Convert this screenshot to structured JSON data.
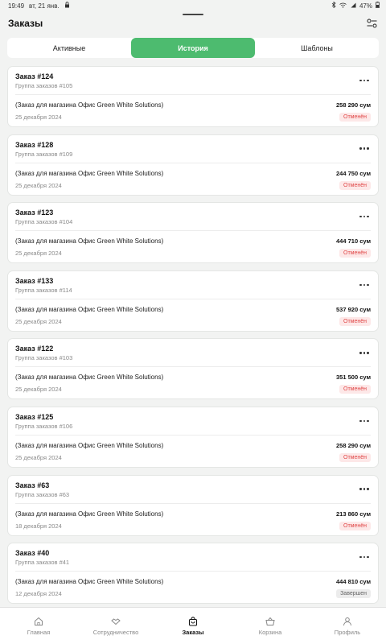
{
  "status_bar": {
    "time": "19:49",
    "date": "вт, 21 янв.",
    "battery": "47%"
  },
  "header": {
    "title": "Заказы"
  },
  "tabs": [
    {
      "label": "Активные",
      "active": false
    },
    {
      "label": "История",
      "active": true
    },
    {
      "label": "Шаблоны",
      "active": false
    }
  ],
  "orders": [
    {
      "title": "Заказ #124",
      "group": "Группа заказов #105",
      "shop": "(Заказ для магазина Офис Green White Solutions)",
      "date": "25 декабря 2024",
      "amount": "258 290 сум",
      "status": "Отменён",
      "status_type": "cancelled"
    },
    {
      "title": "Заказ #128",
      "group": "Группа заказов #109",
      "shop": "(Заказ для магазина Офис Green White Solutions)",
      "date": "25 декабря 2024",
      "amount": "244 750 сум",
      "status": "Отменён",
      "status_type": "cancelled"
    },
    {
      "title": "Заказ #123",
      "group": "Группа заказов #104",
      "shop": "(Заказ для магазина Офис Green White Solutions)",
      "date": "25 декабря 2024",
      "amount": "444 710 сум",
      "status": "Отменён",
      "status_type": "cancelled"
    },
    {
      "title": "Заказ #133",
      "group": "Группа заказов #114",
      "shop": "(Заказ для магазина Офис Green White Solutions)",
      "date": "25 декабря 2024",
      "amount": "537 920 сум",
      "status": "Отменён",
      "status_type": "cancelled"
    },
    {
      "title": "Заказ #122",
      "group": "Группа заказов #103",
      "shop": "(Заказ для магазина Офис Green White Solutions)",
      "date": "25 декабря 2024",
      "amount": "351 500 сум",
      "status": "Отменён",
      "status_type": "cancelled"
    },
    {
      "title": "Заказ #125",
      "group": "Группа заказов #106",
      "shop": "(Заказ для магазина Офис Green White Solutions)",
      "date": "25 декабря 2024",
      "amount": "258 290 сум",
      "status": "Отменён",
      "status_type": "cancelled"
    },
    {
      "title": "Заказ #63",
      "group": "Группа заказов #63",
      "shop": "(Заказ для магазина Офис Green White Solutions)",
      "date": "18 декабря 2024",
      "amount": "213 860 сум",
      "status": "Отменён",
      "status_type": "cancelled"
    },
    {
      "title": "Заказ #40",
      "group": "Группа заказов #41",
      "shop": "(Заказ для магазина Офис Green White Solutions)",
      "date": "12 декабря 2024",
      "amount": "444 810 сум",
      "status": "Завершен",
      "status_type": "done"
    }
  ],
  "bottom_nav": [
    {
      "label": "Главная",
      "icon": "home-icon",
      "active": false
    },
    {
      "label": "Сотрудничество",
      "icon": "handshake-icon",
      "active": false
    },
    {
      "label": "Заказы",
      "icon": "bag-icon",
      "active": true
    },
    {
      "label": "Корзина",
      "icon": "basket-icon",
      "active": false
    },
    {
      "label": "Профиль",
      "icon": "user-icon",
      "active": false
    }
  ],
  "colors": {
    "accent": "#4dbb6f",
    "cancelled": "#e04848",
    "background": "#f2f3f2"
  }
}
